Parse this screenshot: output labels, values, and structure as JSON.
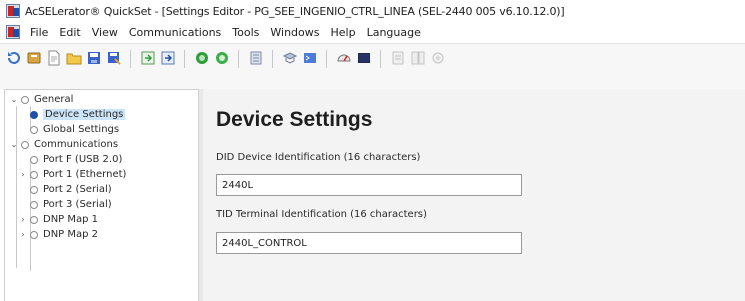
{
  "window": {
    "title": "AcSELerator® QuickSet - [Settings Editor - PG_SEE_INGENIO_CTRL_LINEA (SEL-2440 005 v6.10.12.0)]"
  },
  "menu": [
    "File",
    "Edit",
    "View",
    "Communications",
    "Tools",
    "Windows",
    "Help",
    "Language"
  ],
  "tree": {
    "items": [
      {
        "label": "General",
        "expanded": true,
        "icon": "settings-node-icon"
      },
      {
        "label": "Device Settings",
        "selected": true,
        "icon": "bullet-icon"
      },
      {
        "label": "Global Settings",
        "icon": "settings-node-icon"
      },
      {
        "label": "Communications",
        "expanded": true,
        "icon": "settings-node-icon"
      },
      {
        "label": "Port F (USB 2.0)",
        "icon": "settings-node-icon"
      },
      {
        "label": "Port 1 (Ethernet)",
        "expandable": true,
        "icon": "settings-node-icon"
      },
      {
        "label": "Port 2 (Serial)",
        "icon": "settings-node-icon"
      },
      {
        "label": "Port 3 (Serial)",
        "icon": "settings-node-icon"
      },
      {
        "label": "DNP Map 1",
        "expandable": true,
        "icon": "settings-node-icon"
      },
      {
        "label": "DNP Map 2",
        "expandable": true,
        "icon": "settings-node-icon"
      }
    ]
  },
  "main": {
    "title": "Device Settings",
    "fields": [
      {
        "label": "DID Device Identification (16 characters)",
        "value": "2440L"
      },
      {
        "label": "TID Terminal Identification (16 characters)",
        "value": "2440L_CONTROL"
      }
    ]
  },
  "colors": {
    "selection": "#cce4f7",
    "content_background": "#f3f3f3",
    "toolbar_green": "#2e9d3a",
    "toolbar_blue": "#1e4fa8"
  }
}
